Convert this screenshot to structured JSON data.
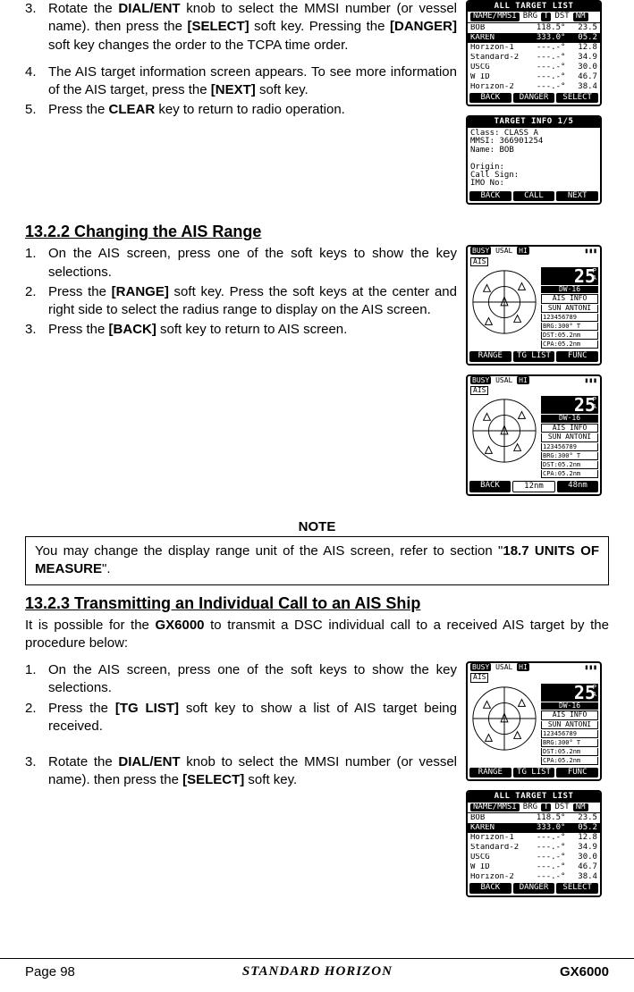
{
  "steps_a": [
    {
      "num": "3.",
      "html": "Rotate the <b>DIAL/ENT</b> knob to select the MMSI number (or vessel name). then press the <b>[SELECT]</b> soft key. Pressing the <b>[DANGER]</b> soft key changes the order to the TCPA time order."
    },
    {
      "num": "4.",
      "html": "The AIS target information screen appears. To see more information of the AIS target, press the <b>[NEXT]</b> soft key."
    },
    {
      "num": "5.",
      "html": "Press the <b>CLEAR</b> key to return to radio operation."
    }
  ],
  "sec2_title": "13.2.2    Changing the AIS Range",
  "steps_b": [
    {
      "num": "1.",
      "html": "On the AIS screen, press one of the soft keys to show the key selections."
    },
    {
      "num": "2.",
      "html": "Press the <b>[RANGE]</b> soft key. Press the soft keys at the center and right side to select the radius range to display on the AIS screen."
    },
    {
      "num": "3.",
      "html": "Press the <b>[BACK]</b> soft key to return to AIS screen."
    }
  ],
  "note_title": "NOTE",
  "note_text_pre": "You may change the display range unit of the AIS screen, refer to section \"",
  "note_text_bold": "18.7 UNITS OF MEASURE",
  "note_text_post": "\".",
  "sec3_title": "13.2.3    Transmitting an Individual Call to an AIS Ship",
  "intro_pre": "It is possible for the ",
  "intro_bold": "GX6000",
  "intro_post": " to transmit a DSC individual call to a received AIS target by the procedure below:",
  "steps_c": [
    {
      "num": "1.",
      "html": "On the AIS screen, press one of the soft keys to show the key selections."
    },
    {
      "num": "2.",
      "html": "Press the <b>[TG LIST]</b> soft key to show a list of AIS target being received."
    },
    {
      "num": "3.",
      "html": "Rotate the <b>DIAL/ENT</b> knob to select the MMSI number (or vessel name). then press the <b>[SELECT]</b> soft key."
    }
  ],
  "footer": {
    "page": "Page 98",
    "brand": "STANDARD HORIZON",
    "model": "GX6000"
  },
  "lcd_list": {
    "title": "ALL TARGET LIST",
    "hdr": {
      "a": "NAME/MMSI",
      "b": "BRG",
      "c": "T",
      "d": "DST",
      "e": "NM"
    },
    "rows": [
      {
        "name": "BOB",
        "brg": "118.5°",
        "dst": "23.5",
        "inv": false
      },
      {
        "name": "KAREN",
        "brg": "333.0°",
        "dst": "05.2",
        "inv": true
      },
      {
        "name": "Horizon-1",
        "brg": "---.-°",
        "dst": "12.8",
        "inv": false
      },
      {
        "name": "Standard-2",
        "brg": "---.-°",
        "dst": "34.9",
        "inv": false
      },
      {
        "name": "USCG",
        "brg": "---.-°",
        "dst": "30.0",
        "inv": false
      },
      {
        "name": "W ID",
        "brg": "---.-°",
        "dst": "46.7",
        "inv": false
      },
      {
        "name": "Horizon-2",
        "brg": "---.-°",
        "dst": "38.4",
        "inv": false
      }
    ],
    "soft": [
      "BACK",
      "DANGER",
      "SELECT"
    ]
  },
  "lcd_info": {
    "title": "TARGET INFO   1/5",
    "lines": [
      "Class: CLASS A",
      " MMSI: 366901254",
      " Name: BOB",
      "",
      "Origin:",
      "Call Sign:",
      "IMO No:"
    ],
    "soft": [
      "BACK",
      "CALL",
      "NEXT"
    ]
  },
  "lcd_ais": {
    "busy": "BUSY",
    "usa": "USAL",
    "hi": "HI",
    "bat": "▮▮▮",
    "ais": "AIS",
    "big": "25",
    "pa": "P\nA",
    "dw": "DW·16",
    "info_title": "AIS INFO",
    "info_name": "SUN ANTONI",
    "fields": [
      "123456789",
      "BRG:300° T",
      "DST:05.2nm",
      "CPA:05.2nm"
    ],
    "soft1": [
      "RANGE",
      "TG LIST",
      "FUNC"
    ],
    "soft2": [
      "BACK",
      "12nm",
      "48nm"
    ]
  }
}
